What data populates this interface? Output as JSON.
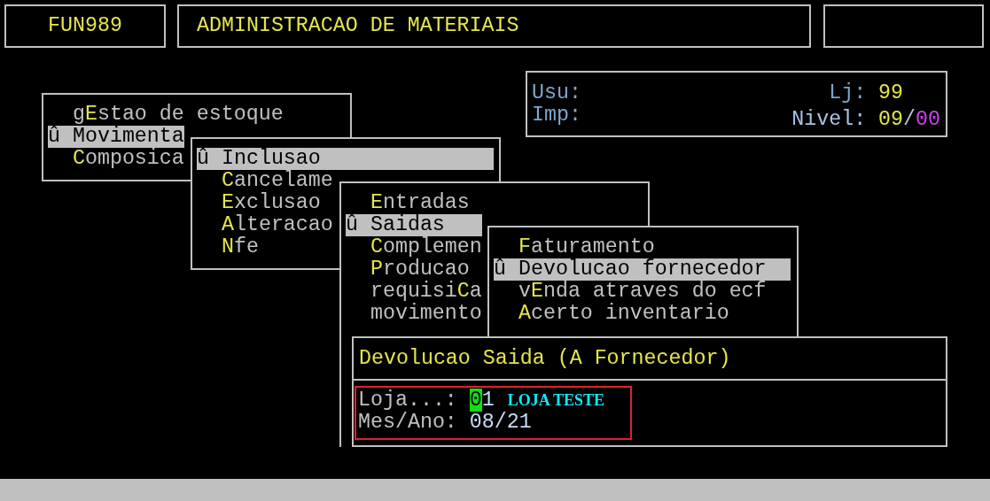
{
  "header": {
    "program": "FUN989",
    "title": "ADMINISTRACAO DE MATERIAIS"
  },
  "info": {
    "usu_label": "Usu:",
    "imp_label": "Imp:",
    "lj_label": "Lj:",
    "lj_value": "99",
    "nivel_label": "Nivel:",
    "nivel_value": "**09**/*00*"
  },
  "menus": [
    {
      "items": [
        {
          "label": "g**E**stao de estoque",
          "selected": false
        },
        {
          "marker": "û",
          "label": "Movimenta",
          "selected": true
        },
        {
          "label": "**C**omposica",
          "selected": false
        }
      ]
    },
    {
      "items": [
        {
          "marker": "û",
          "label": "Inclusao",
          "selected": true
        },
        {
          "label": "**C**ancelame",
          "selected": false
        },
        {
          "label": "**E**xclusao",
          "selected": false
        },
        {
          "label": "**A**lteracao",
          "selected": false
        },
        {
          "label": "**N**fe",
          "selected": false
        }
      ]
    },
    {
      "items": [
        {
          "label": "**E**ntradas",
          "selected": false
        },
        {
          "marker": "û",
          "label": "Saidas",
          "selected": true
        },
        {
          "label": "**C**omplemen",
          "selected": false
        },
        {
          "label": "**P**roducao",
          "selected": false
        },
        {
          "label": "requisi**C**a",
          "selected": false
        },
        {
          "label": "movimento",
          "selected": false
        }
      ]
    },
    {
      "items": [
        {
          "label": "**F**aturamento",
          "selected": false
        },
        {
          "marker": "û",
          "label": "Devolucao fornecedor",
          "selected": true
        },
        {
          "label": "v**E**nda atraves do ecf",
          "selected": false
        },
        {
          "label": "**A**certo inventario",
          "selected": false
        }
      ]
    }
  ],
  "dialog": {
    "title": "Devolucao Saida (A Fornecedor)",
    "annotation_frame": true,
    "fields": [
      {
        "label": "Loja...:",
        "value": "**0**1",
        "description": "LOJA TESTE"
      },
      {
        "label": "Mes/Ano:",
        "value": "08/21"
      }
    ]
  }
}
